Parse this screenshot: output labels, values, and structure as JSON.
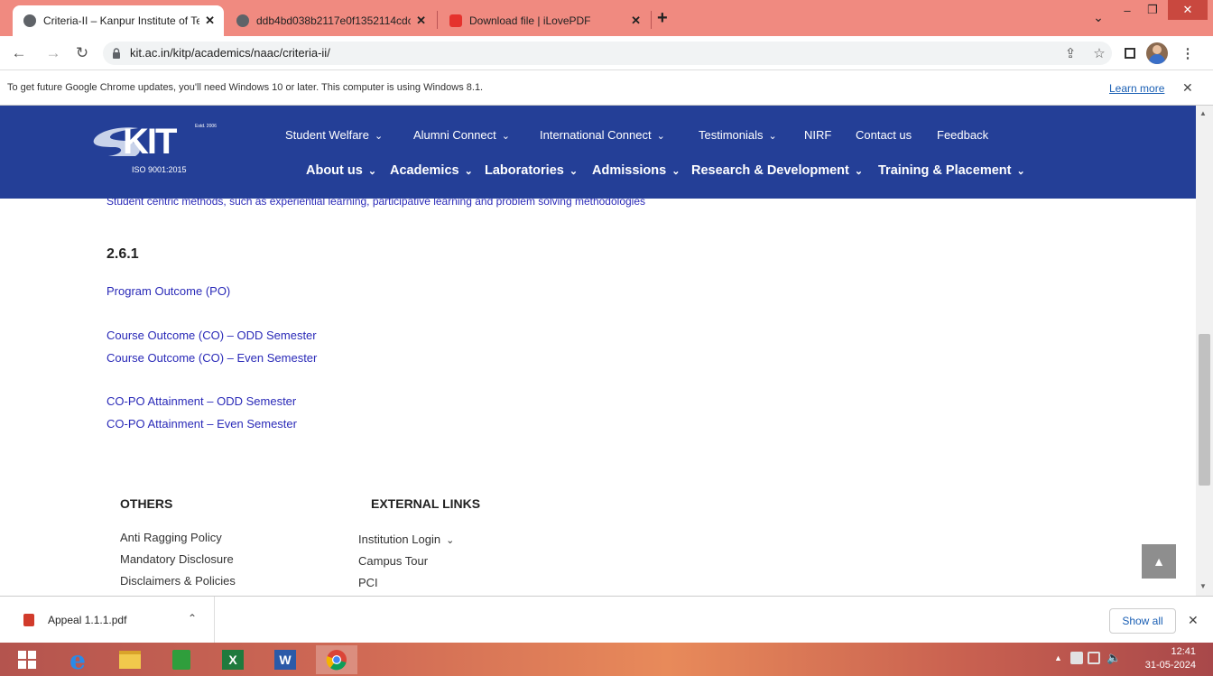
{
  "tabs": [
    {
      "title": "Criteria-II – Kanpur Institute of Te",
      "close": "✕"
    },
    {
      "title": "ddb4bd038b2117e0f1352114cdc",
      "close": "✕"
    },
    {
      "title": "Download file | iLovePDF",
      "close": "✕"
    }
  ],
  "new_tab": "+",
  "window_controls": {
    "dropdown": "⌄",
    "minimize": "–",
    "restore": "❐",
    "close": "✕"
  },
  "toolbar": {
    "url": "kit.ac.in/kitp/academics/naac/criteria-ii/"
  },
  "infobar": {
    "message": "To get future Google Chrome updates, you'll need Windows 10 or later. This computer is using Windows 8.1.",
    "learn_more": "Learn more",
    "close": "✕"
  },
  "site": {
    "logo_text": "KIT",
    "logo_est": "Estd. 2006",
    "logo_iso": "ISO 9001:2015",
    "top_nav": [
      {
        "label": "Student Welfare",
        "dropdown": true
      },
      {
        "label": "Alumni Connect",
        "dropdown": true
      },
      {
        "label": "International Connect",
        "dropdown": true
      },
      {
        "label": "Testimonials",
        "dropdown": true
      },
      {
        "label": "NIRF",
        "dropdown": false
      },
      {
        "label": "Contact us",
        "dropdown": false
      },
      {
        "label": "Feedback",
        "dropdown": false
      }
    ],
    "main_nav": [
      {
        "label": "About us"
      },
      {
        "label": "Academics"
      },
      {
        "label": "Laboratories"
      },
      {
        "label": "Admissions"
      },
      {
        "label": "Research & Development"
      },
      {
        "label": "Training & Placement"
      }
    ]
  },
  "content": {
    "partial_link": "Student centric methods, such as experiential learning, participative learning and problem solving methodologies",
    "section_heading": "2.6.1",
    "links": [
      "Program Outcome (PO)",
      "Course Outcome (CO) – ODD Semester",
      "Course Outcome (CO) – Even Semester",
      "CO-PO Attainment – ODD Semester",
      "CO-PO Attainment – Even Semester"
    ]
  },
  "footer": {
    "others": {
      "heading": "OTHERS",
      "links": [
        "Anti Ragging Policy",
        "Mandatory Disclosure",
        "Disclaimers & Policies"
      ]
    },
    "external": {
      "heading": "EXTERNAL LINKS",
      "links": [
        "Institution Login",
        "Campus Tour",
        "PCI"
      ]
    }
  },
  "scroll_top_icon": "chevron-up",
  "downloads": {
    "file": "Appeal 1.1.1.pdf",
    "show_all": "Show all",
    "close": "✕"
  },
  "taskbar": {
    "time": "12:41",
    "date": "31-05-2024"
  }
}
